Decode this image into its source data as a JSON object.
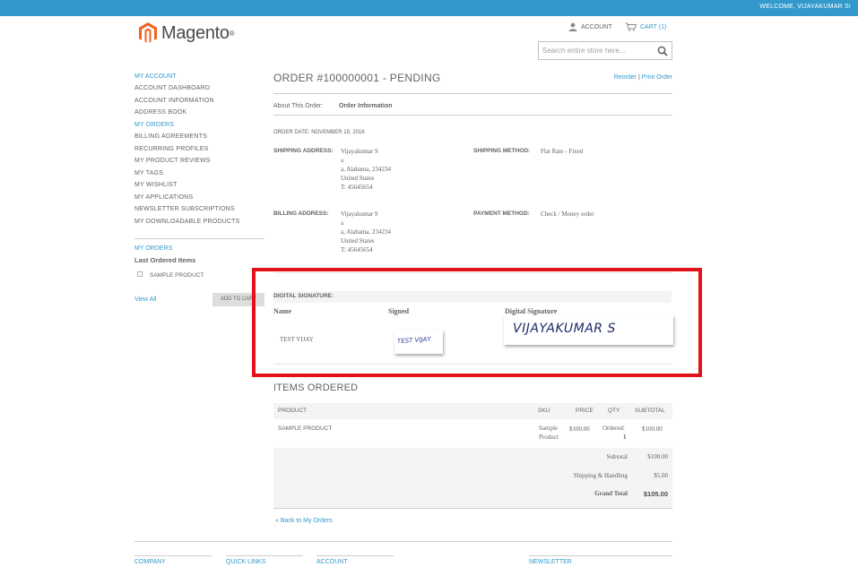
{
  "header": {
    "welcome": "WELCOME, VIJAYAKUMAR S!",
    "logo_text": "Magento",
    "logo_reg": "®",
    "account_label": "ACCOUNT",
    "cart_label": "CART (1)",
    "search_placeholder": "Search entire store here..."
  },
  "sidebar": {
    "title": "MY ACCOUNT",
    "items": [
      {
        "label": "ACCOUNT DASHBOARD"
      },
      {
        "label": "ACCOUNT INFORMATION"
      },
      {
        "label": "ADDRESS BOOK"
      },
      {
        "label": "MY ORDERS"
      },
      {
        "label": "BILLING AGREEMENTS"
      },
      {
        "label": "RECURRING PROFILES"
      },
      {
        "label": "MY PRODUCT REVIEWS"
      },
      {
        "label": "MY TAGS"
      },
      {
        "label": "MY WISHLIST"
      },
      {
        "label": "MY APPLICATIONS"
      },
      {
        "label": "NEWSLETTER SUBSCRIPTIONS"
      },
      {
        "label": "MY DOWNLOADABLE PRODUCTS"
      }
    ],
    "orders_title": "MY ORDERS",
    "last_ordered_title": "Last Ordered Items",
    "last_item": "SAMPLE PRODUCT",
    "view_all": "View All",
    "add_to_cart": "ADD TO CART"
  },
  "order": {
    "title": "ORDER #100000001 - PENDING",
    "reorder": "Reorder",
    "separator": "|",
    "print": "Print Order",
    "about_label": "About This Order:",
    "tab_info": "Order Information",
    "order_date": "ORDER DATE: NOVEMBER 19, 2016",
    "shipping_address_label": "SHIPPING ADDRESS:",
    "shipping_address": [
      "Vijayakumar S",
      "a",
      "a, Alabama, 234234",
      "United States",
      "T: 45645654"
    ],
    "shipping_method_label": "SHIPPING METHOD:",
    "shipping_method": "Flat Rate - Fixed",
    "billing_address_label": "BILLING ADDRESS:",
    "billing_address": [
      "Vijayakumar S",
      "a",
      "a, Alabama, 234234",
      "United States",
      "T: 45645654"
    ],
    "payment_method_label": "PAYMENT METHOD:",
    "payment_method": "Check / Money order"
  },
  "signature": {
    "section_title": "DIGITAL SIGNATURE:",
    "col_name": "Name",
    "col_signed": "Signed",
    "col_digital": "Digital Signature",
    "name_value": "TEST VIJAY",
    "signed_handwriting": "TEST VIJAY",
    "digital_handwriting": "VIJAYAKUMAR S"
  },
  "items": {
    "title": "ITEMS ORDERED",
    "headers": {
      "product": "PRODUCT",
      "sku": "SKU",
      "price": "PRICE",
      "qty": "QTY",
      "subtotal": "SUBTOTAL"
    },
    "row": {
      "product": "SAMPLE PRODUCT",
      "sku_line1": "Sample",
      "sku_line2": "Product",
      "price": "$100.00",
      "qty_label": "Ordered:",
      "qty_value": "1",
      "subtotal": "$100.00"
    },
    "totals": [
      {
        "label": "Subtotal",
        "value": "$100.00"
      },
      {
        "label": "Shipping & Handling",
        "value": "$5.00"
      },
      {
        "label": "Grand Total",
        "value": "$105.00"
      }
    ],
    "back_link": "« Back to My Orders"
  },
  "footer": {
    "company": "COMPANY",
    "quick_links": "QUICK LINKS",
    "account": "ACCOUNT",
    "newsletter": "NEWSLETTER"
  },
  "colors": {
    "accent": "#3399cc",
    "highlight": "#e0131b",
    "logo": "#f26322"
  }
}
